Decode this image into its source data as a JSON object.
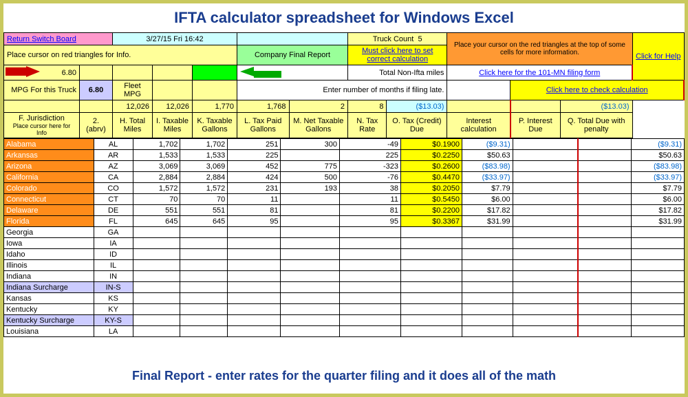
{
  "title": "IFTA calculator spreadsheet for Windows Excel",
  "header": {
    "return_switch_board": "Return Switch Board",
    "datetime": "3/27/15 Fri 16:42",
    "truck_count_label": "Truck Count",
    "truck_count": "5",
    "cursor_tip": "Place your cursor on the red triangles at the top of some cells for more information.",
    "click_help": "Click for Help",
    "cursor_info": "Place cursor on red triangles for Info.",
    "company_final_report": "Company Final Report",
    "must_click": "Must click here to set correct calculation",
    "mpg_value": "6.80",
    "mpg_label": "MPG For this Truck",
    "fleet_mpg_value": "6.80",
    "fleet_mpg_label": "Fleet MPG",
    "total_non_ifta": "Total Non-Ifta miles",
    "click_101mn": "Click here for the 101-MN filing form",
    "enter_months": "Enter number of months if filing late.",
    "check_calc": "Click here to check calculation"
  },
  "totals": {
    "h": "12,026",
    "i": "12,026",
    "k": "1,770",
    "l": "1,768",
    "m": "2",
    "n": "8",
    "o": "($13.03)",
    "q": "($13.03)"
  },
  "columns": {
    "a": "F. Jurisdiction",
    "a_sub": "Place cursor here for Info",
    "b": "2. (abrv)",
    "c": "H. Total Miles",
    "d": "I. Taxable Miles",
    "e": "K. Taxable Gallons",
    "f": "L. Tax Paid Gallons",
    "g": "M. Net Taxable Gallons",
    "h": "N. Tax Rate",
    "i": "O. Tax (Credit) Due",
    "j": "Interest calculation",
    "k": "P. Interest Due",
    "l": "Q. Total Due with penalty"
  },
  "rows": [
    {
      "name": "Alabama",
      "ab": "AL",
      "h": "1,702",
      "i": "1,702",
      "k": "251",
      "l": "300",
      "m": "-49",
      "n": "$0.1900",
      "o": "($9.31)",
      "q": "($9.31)",
      "hl": true
    },
    {
      "name": "Arkansas",
      "ab": "AR",
      "h": "1,533",
      "i": "1,533",
      "k": "225",
      "l": "",
      "m": "225",
      "n": "$0.2250",
      "o": "$50.63",
      "q": "$50.63",
      "hl": true
    },
    {
      "name": "Arizona",
      "ab": "AZ",
      "h": "3,069",
      "i": "3,069",
      "k": "452",
      "l": "775",
      "m": "-323",
      "n": "$0.2600",
      "o": "($83.98)",
      "q": "($83.98)",
      "hl": true
    },
    {
      "name": "California",
      "ab": "CA",
      "h": "2,884",
      "i": "2,884",
      "k": "424",
      "l": "500",
      "m": "-76",
      "n": "$0.4470",
      "o": "($33.97)",
      "q": "($33.97)",
      "hl": true
    },
    {
      "name": "Colorado",
      "ab": "CO",
      "h": "1,572",
      "i": "1,572",
      "k": "231",
      "l": "193",
      "m": "38",
      "n": "$0.2050",
      "o": "$7.79",
      "q": "$7.79",
      "hl": true
    },
    {
      "name": "Connecticut",
      "ab": "CT",
      "h": "70",
      "i": "70",
      "k": "11",
      "l": "",
      "m": "11",
      "n": "$0.5450",
      "o": "$6.00",
      "q": "$6.00",
      "hl": true
    },
    {
      "name": "Delaware",
      "ab": "DE",
      "h": "551",
      "i": "551",
      "k": "81",
      "l": "",
      "m": "81",
      "n": "$0.2200",
      "o": "$17.82",
      "q": "$17.82",
      "hl": true
    },
    {
      "name": "Florida",
      "ab": "FL",
      "h": "645",
      "i": "645",
      "k": "95",
      "l": "",
      "m": "95",
      "n": "$0.3367",
      "o": "$31.99",
      "q": "$31.99",
      "hl": true
    },
    {
      "name": "Georgia",
      "ab": "GA"
    },
    {
      "name": "Iowa",
      "ab": "IA"
    },
    {
      "name": "Idaho",
      "ab": "ID"
    },
    {
      "name": "Illinois",
      "ab": "IL"
    },
    {
      "name": "Indiana",
      "ab": "IN"
    },
    {
      "name": "Indiana Surcharge",
      "ab": "IN-S",
      "sur": true
    },
    {
      "name": "Kansas",
      "ab": "KS"
    },
    {
      "name": "Kentucky",
      "ab": "KY"
    },
    {
      "name": "Kentucky Surcharge",
      "ab": "KY-S",
      "sur": true
    },
    {
      "name": "Louisiana",
      "ab": "LA"
    }
  ],
  "footer": "Final Report - enter rates for the quarter filing and it does all of the math"
}
